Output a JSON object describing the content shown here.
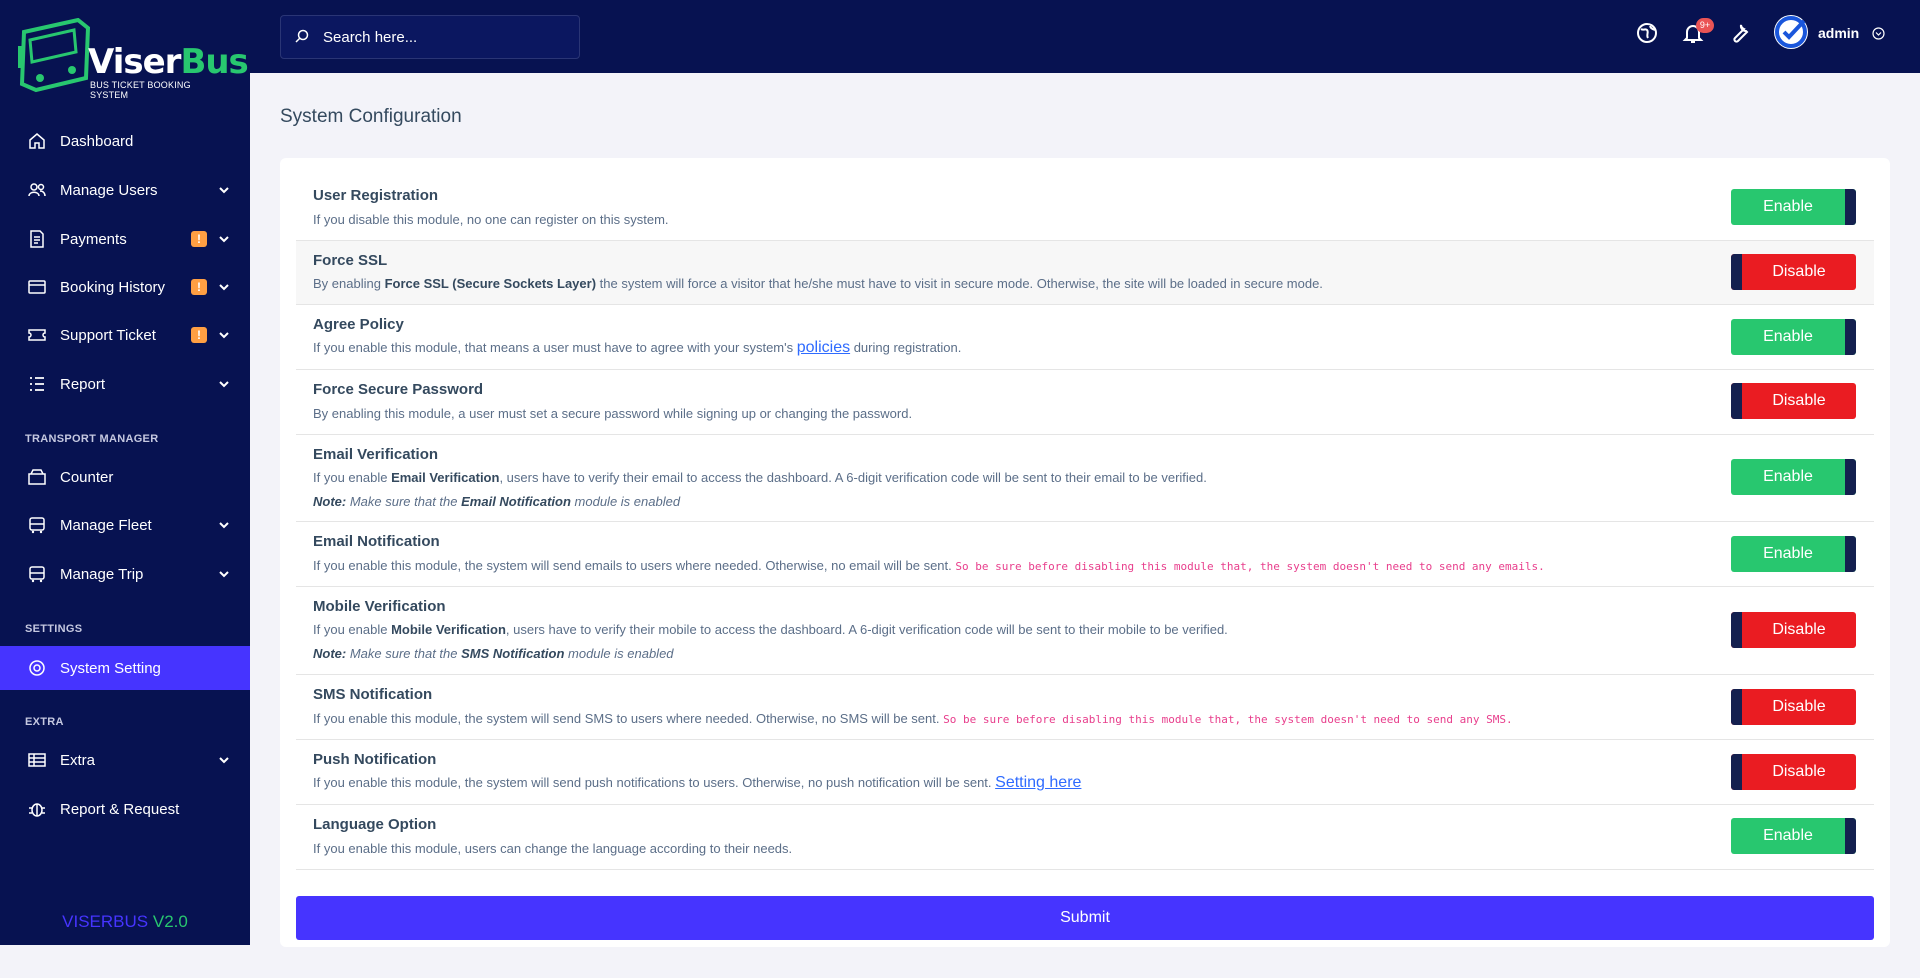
{
  "brand": {
    "name_a": "Viser",
    "name_b": "Bus",
    "tagline": "BUS TICKET BOOKING SYSTEM"
  },
  "sidebar": {
    "items": [
      {
        "label": "Dashboard"
      },
      {
        "label": "Manage Users"
      },
      {
        "label": "Payments",
        "badge": "!"
      },
      {
        "label": "Booking History",
        "badge": "!"
      },
      {
        "label": "Support Ticket",
        "badge": "!"
      },
      {
        "label": "Report"
      },
      {
        "label": "Counter"
      },
      {
        "label": "Manage Fleet"
      },
      {
        "label": "Manage Trip"
      },
      {
        "label": "System Setting"
      },
      {
        "label": "Extra"
      },
      {
        "label": "Report & Request"
      }
    ],
    "sections": [
      "TRANSPORT MANAGER",
      "SETTINGS",
      "EXTRA"
    ],
    "version_a": "VISERBUS",
    "version_b": "V2.0"
  },
  "topbar": {
    "search_placeholder": "Search here...",
    "notif_count": "9+",
    "user": "admin"
  },
  "page": {
    "title": "System Configuration",
    "submit_label": "Submit"
  },
  "settings": [
    {
      "title": "User Registration",
      "desc": "If you disable this module, no one can register on this system.",
      "state": "Enable"
    },
    {
      "title": "Force SSL",
      "desc_a": "By enabling ",
      "desc_b": "Force SSL (Secure Sockets Layer)",
      "desc_c": " the system will force a visitor that he/she must have to visit in secure mode. Otherwise, the site will be loaded in secure mode.",
      "state": "Disable"
    },
    {
      "title": "Agree Policy",
      "desc_a": "If you enable this module, that means a user must have to agree with your system's ",
      "link": "policies",
      "desc_c": " during registration.",
      "state": "Enable"
    },
    {
      "title": "Force Secure Password",
      "desc": "By enabling this module, a user must set a secure password while signing up or changing the password.",
      "state": "Disable"
    },
    {
      "title": "Email Verification",
      "desc_a": "If you enable ",
      "desc_b": "Email Verification",
      "desc_c": ", users have to verify their email to access the dashboard. A 6-digit verification code will be sent to their email to be verified.",
      "note_a": "Note:",
      "note_b": " Make sure that the ",
      "note_c": "Email Notification",
      "note_d": " module is enabled",
      "state": "Enable"
    },
    {
      "title": "Email Notification",
      "desc": "If you enable this module, the system will send emails to users where needed. Otherwise, no email will be sent. ",
      "code": "So be sure before disabling this module that, the system doesn't need to send any emails.",
      "state": "Enable"
    },
    {
      "title": "Mobile Verification",
      "desc_a": "If you enable ",
      "desc_b": "Mobile Verification",
      "desc_c": ", users have to verify their mobile to access the dashboard. A 6-digit verification code will be sent to their mobile to be verified.",
      "note_a": "Note:",
      "note_b": " Make sure that the ",
      "note_c": "SMS Notification",
      "note_d": " module is enabled",
      "state": "Disable"
    },
    {
      "title": "SMS Notification",
      "desc": "If you enable this module, the system will send SMS to users where needed. Otherwise, no SMS will be sent. ",
      "code": "So be sure before disabling this module that, the system doesn't need to send any SMS.",
      "state": "Disable"
    },
    {
      "title": "Push Notification",
      "desc": "If you enable this module, the system will send push notifications to users. Otherwise, no push notification will be sent. ",
      "link": "Setting here",
      "state": "Disable"
    },
    {
      "title": "Language Option",
      "desc": "If you enable this module, users can change the language according to their needs.",
      "state": "Enable"
    }
  ]
}
